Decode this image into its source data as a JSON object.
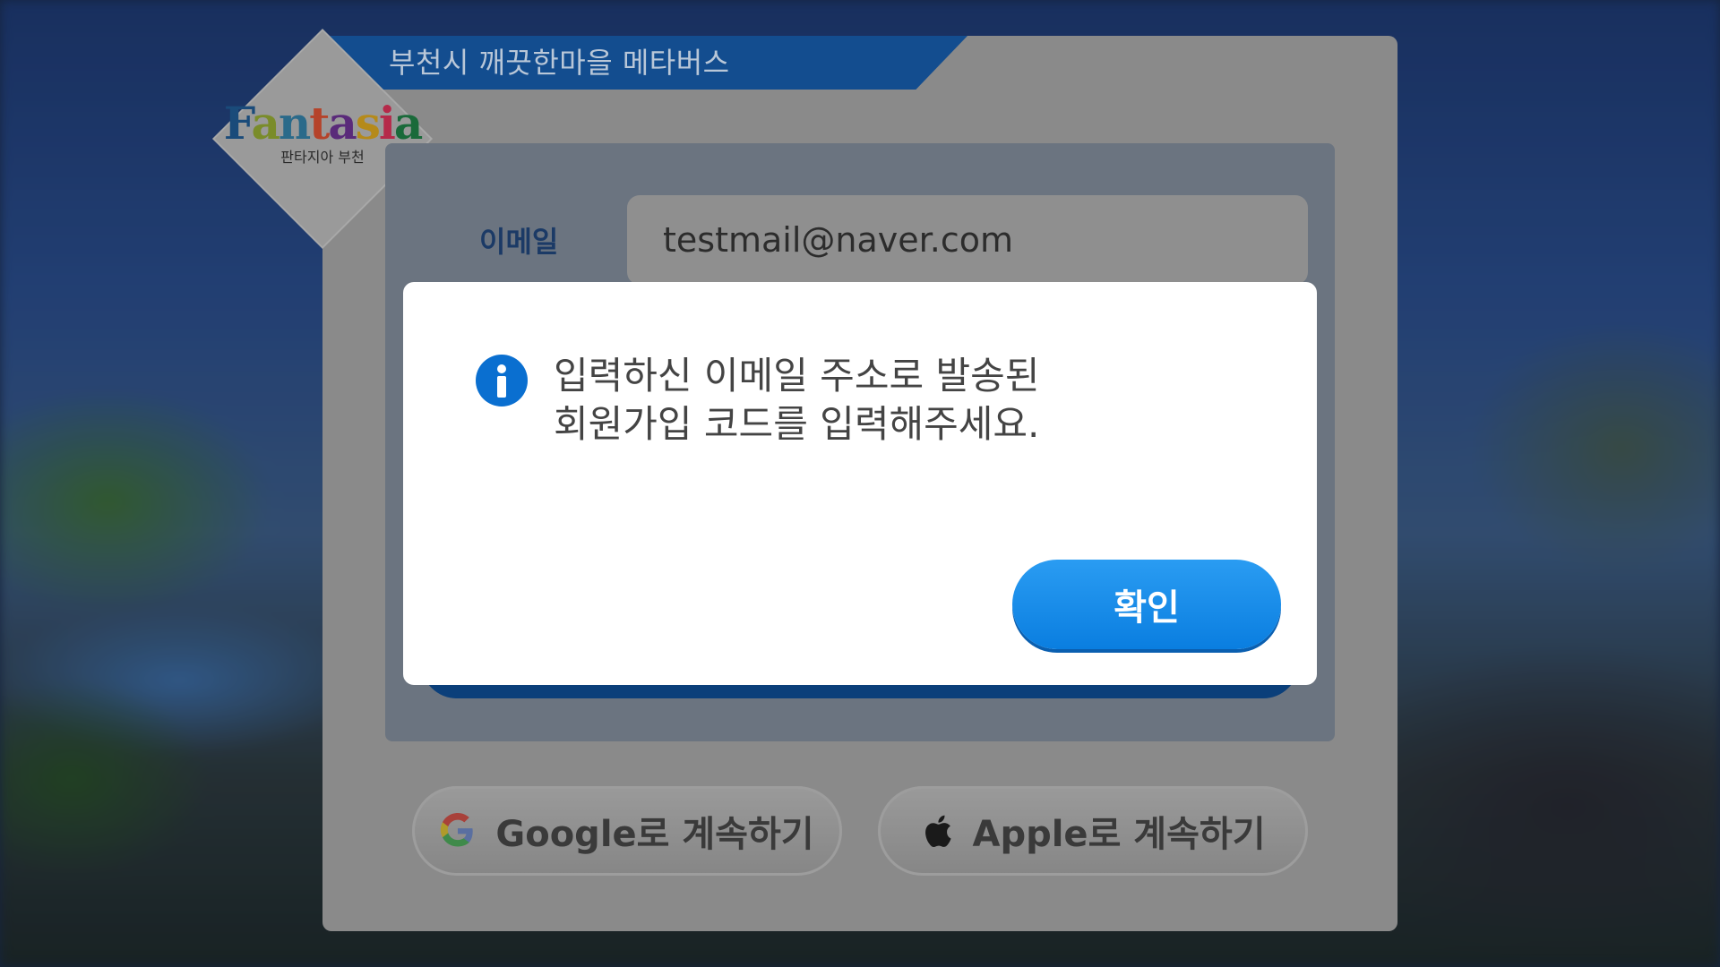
{
  "header": {
    "title": "부천시 깨끗한마을 메타버스"
  },
  "logo": {
    "text_letters": [
      "F",
      "a",
      "n",
      "t",
      "a",
      "s",
      "i",
      "a"
    ],
    "subtitle": "판타지아 부천"
  },
  "form": {
    "email_label": "이메일",
    "email_value": "testmail@naver.com"
  },
  "social": {
    "google_label": "Google로 계속하기",
    "apple_label": "Apple로 계속하기"
  },
  "modal": {
    "message_line1": "입력하신 이메일 주소로 발송된",
    "message_line2": "회원가입 코드를 입력해주세요.",
    "confirm_label": "확인",
    "icon": "info-icon"
  },
  "colors": {
    "accent": "#0a7ee0",
    "header_ribbon": "#134d8f"
  }
}
